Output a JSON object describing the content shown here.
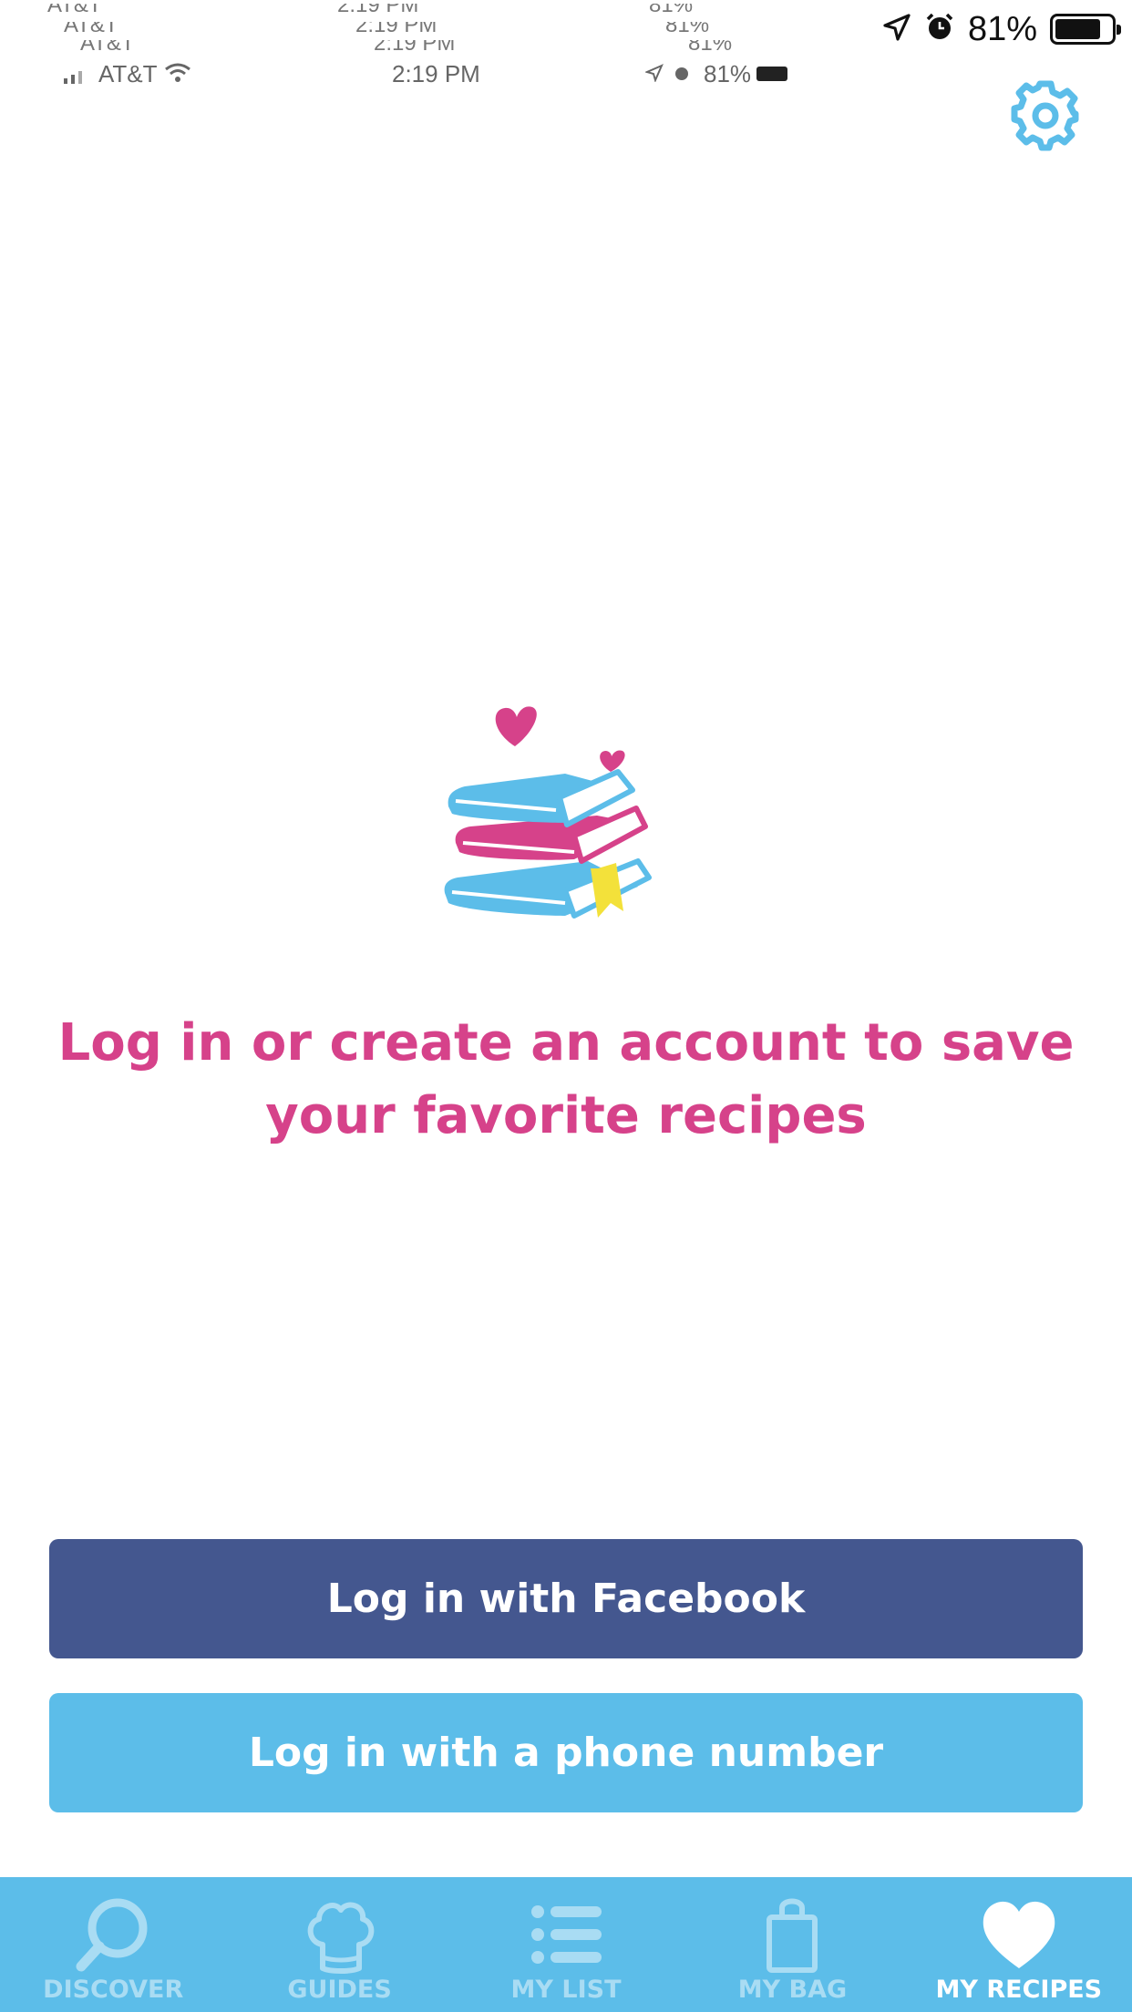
{
  "status_bar": {
    "carrier": "AT&T",
    "time": "2:19 PM",
    "battery_small": "81%",
    "battery_top": "81%",
    "battery_level": 0.81
  },
  "header": {
    "settings_icon": "gear-icon"
  },
  "empty_state": {
    "illustration": "books-with-hearts",
    "message": "Log in or create an account to save your favorite recipes"
  },
  "login": {
    "facebook_label": "Log in with Facebook",
    "phone_label": "Log in with a phone number"
  },
  "tabs": [
    {
      "label": "DISCOVER",
      "icon": "search-icon",
      "active": false
    },
    {
      "label": "GUIDES",
      "icon": "chef-hat-icon",
      "active": false
    },
    {
      "label": "MY LIST",
      "icon": "list-icon",
      "active": false
    },
    {
      "label": "MY BAG",
      "icon": "bag-icon",
      "active": false
    },
    {
      "label": "MY RECIPES",
      "icon": "heart-icon",
      "active": true
    }
  ],
  "colors": {
    "accent_pink": "#d6428a",
    "facebook_blue": "#44578f",
    "brand_light_blue": "#5cbde9",
    "tab_inactive": "#a9dcf3",
    "tab_active": "#ffffff"
  }
}
